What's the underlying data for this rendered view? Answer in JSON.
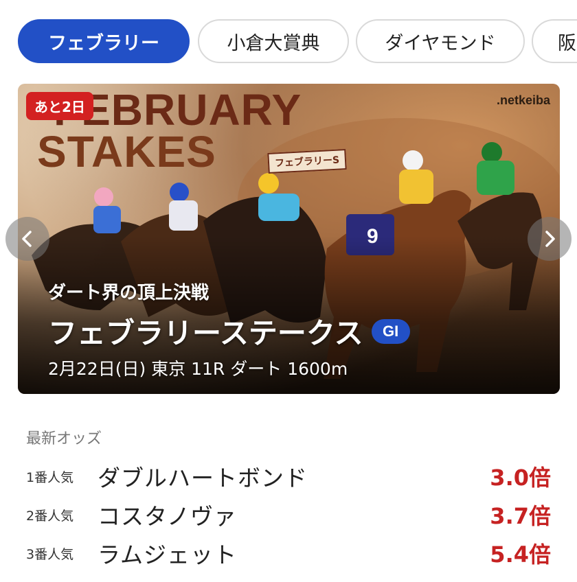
{
  "tabs": [
    {
      "label": "フェブラリー",
      "active": true
    },
    {
      "label": "小倉大賞典",
      "active": false
    },
    {
      "label": "ダイヤモンド",
      "active": false
    },
    {
      "label": "阪",
      "active": false
    }
  ],
  "banner": {
    "days_badge": "あと2日",
    "logo_line1": "FEBRUARY",
    "logo_line2": "STAKES",
    "logo_tag": "フェブラリーS",
    "site_logo": ".netkeiba",
    "subtitle": "ダート界の頂上決戦",
    "title": "フェブラリーステークス",
    "grade": "GI",
    "info": "2月22日(日) 東京 11R ダート 1600m",
    "prev_icon": "chevron-left-icon",
    "next_icon": "chevron-right-icon"
  },
  "odds": {
    "heading": "最新オッズ",
    "rows": [
      {
        "rank": "1番人気",
        "name": "ダブルハートボンド",
        "odds": "3.0倍"
      },
      {
        "rank": "2番人気",
        "name": "コスタノヴァ",
        "odds": "3.7倍"
      },
      {
        "rank": "3番人気",
        "name": "ラムジェット",
        "odds": "5.4倍"
      }
    ]
  },
  "colors": {
    "accent": "#2250c6",
    "odds_red": "#c62222",
    "badge_red": "#d32121"
  }
}
